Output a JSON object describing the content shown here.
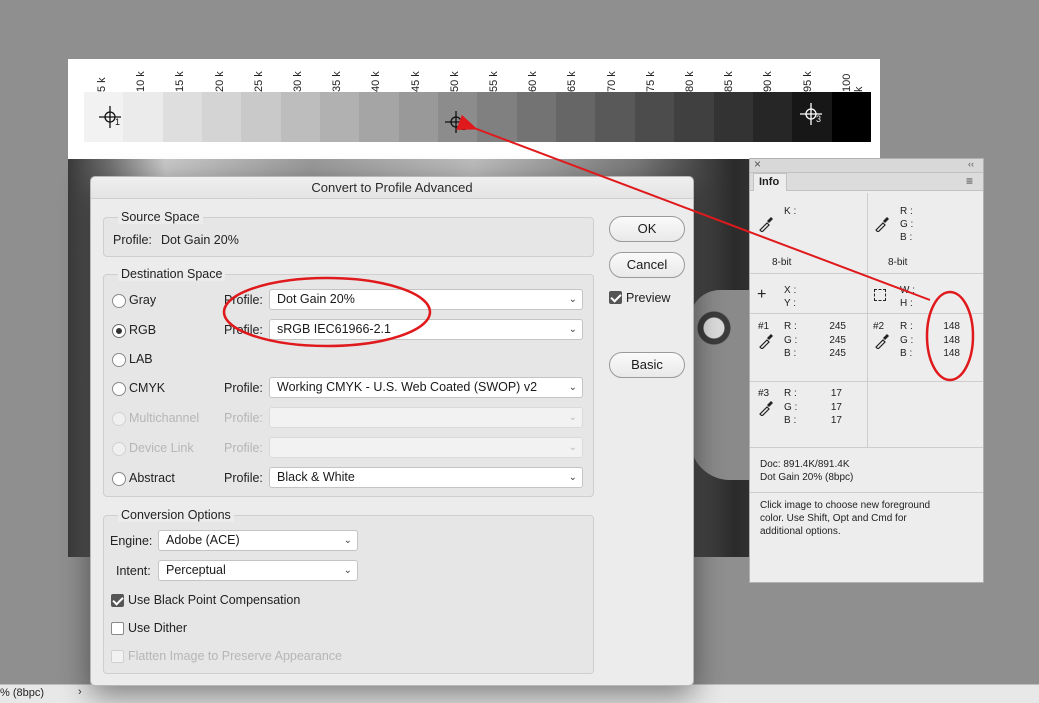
{
  "gray_ramp": {
    "tick_labels": [
      "5 k",
      "10 k",
      "15 k",
      "20 k",
      "25 k",
      "30 k",
      "35 k",
      "40 k",
      "45 k",
      "50 k",
      "55 k",
      "60 k",
      "65 k",
      "70 k",
      "75 k",
      "80 k",
      "85 k",
      "90 k",
      "95 k",
      "100 k"
    ],
    "cell_colors": [
      "#f2f2f2",
      "#ebebeb",
      "#dedede",
      "#d4d4d4",
      "#c9c9c9",
      "#bdbdbd",
      "#b1b1b1",
      "#a5a5a5",
      "#999999",
      "#8c8c8c",
      "#808080",
      "#737373",
      "#666666",
      "#595959",
      "#4c4c4c",
      "#404040",
      "#333333",
      "#262626",
      "#171717",
      "#000000"
    ],
    "samplers": [
      "1",
      "2",
      "3"
    ]
  },
  "status_bar": {
    "text": "% (8bpc)",
    "arrow": "›"
  },
  "dialog": {
    "title": "Convert to Profile Advanced",
    "source_space": {
      "title": "Source Space",
      "profile_label": "Profile:",
      "profile_value": "Dot Gain 20%"
    },
    "destination_space": {
      "title": "Destination Space",
      "options": [
        {
          "label": "Gray",
          "profile_label": "Profile:",
          "profile": "Dot Gain 20%",
          "selected": false,
          "enabled": true
        },
        {
          "label": "RGB",
          "profile_label": "Profile:",
          "profile": "sRGB IEC61966-2.1",
          "selected": true,
          "enabled": true
        },
        {
          "label": "LAB",
          "profile_label": "",
          "profile": "",
          "selected": false,
          "enabled": true
        },
        {
          "label": "CMYK",
          "profile_label": "Profile:",
          "profile": "Working CMYK - U.S. Web Coated (SWOP) v2",
          "selected": false,
          "enabled": true
        },
        {
          "label": "Multichannel",
          "profile_label": "Profile:",
          "profile": "",
          "selected": false,
          "enabled": false
        },
        {
          "label": "Device Link",
          "profile_label": "Profile:",
          "profile": "",
          "selected": false,
          "enabled": false
        },
        {
          "label": "Abstract",
          "profile_label": "Profile:",
          "profile": "Black & White",
          "selected": false,
          "enabled": true
        }
      ]
    },
    "conversion_options": {
      "title": "Conversion Options",
      "engine_label": "Engine:",
      "engine_value": "Adobe (ACE)",
      "intent_label": "Intent:",
      "intent_value": "Perceptual",
      "black_point_label": "Use Black Point Compensation",
      "black_point_checked": true,
      "dither_label": "Use Dither",
      "dither_checked": false,
      "flatten_label": "Flatten Image to Preserve Appearance",
      "flatten_checked": false
    },
    "buttons": {
      "ok": "OK",
      "cancel": "Cancel",
      "basic": "Basic"
    },
    "preview_label": "Preview",
    "preview_checked": true
  },
  "info_panel": {
    "tab_label": "Info",
    "close": "×",
    "collapse": "‹‹",
    "menu": "≡",
    "k_label": "K :",
    "rgb_labels": [
      "R :",
      "G :",
      "B :"
    ],
    "bit_depth_left": "8-bit",
    "bit_depth_right": "8-bit",
    "xy_labels": [
      "X :",
      "Y :"
    ],
    "wh_labels": [
      "W :",
      "H :"
    ],
    "sampler1": {
      "id": "#1",
      "labels": [
        "R :",
        "G :",
        "B :"
      ],
      "values": [
        "245",
        "245",
        "245"
      ]
    },
    "sampler2": {
      "id": "#2",
      "labels": [
        "R :",
        "G :",
        "B :"
      ],
      "values": [
        "148",
        "148",
        "148"
      ]
    },
    "sampler3": {
      "id": "#3",
      "labels": [
        "R :",
        "G :",
        "B :"
      ],
      "values": [
        "17",
        "17",
        "17"
      ]
    },
    "doc_size": "Doc: 891.4K/891.4K",
    "doc_profile": "Dot Gain 20% (8bpc)",
    "help_text": [
      "Click image to choose new foreground",
      "color.  Use Shift, Opt and Cmd for",
      "additional options."
    ]
  },
  "annotation_color": "#e0191c"
}
